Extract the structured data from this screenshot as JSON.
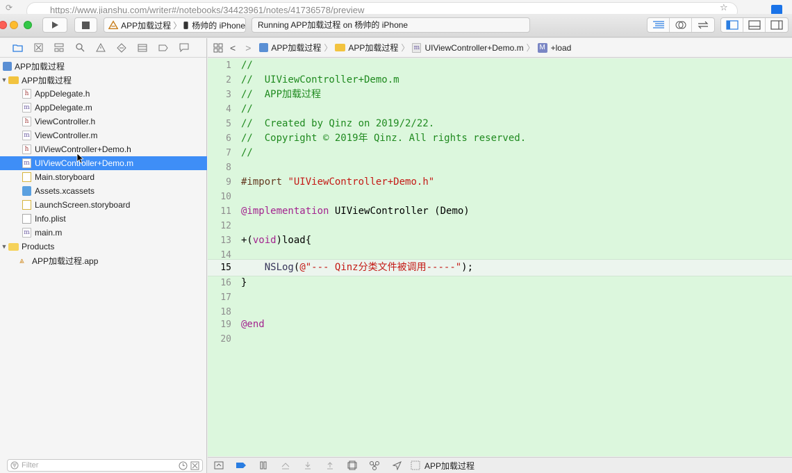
{
  "browser": {
    "url": "https://www.jianshu.com/writer#/notebooks/34423961/notes/41736578/preview"
  },
  "toolbar": {
    "scheme_name": "APP加载过程",
    "device_name": "杨帅的 iPhone",
    "status_text": "Running APP加载过程 on 杨帅的 iPhone"
  },
  "navigator": {
    "project": "APP加载过程",
    "group": "APP加载过程",
    "files": [
      {
        "name": "AppDelegate.h",
        "type": "h"
      },
      {
        "name": "AppDelegate.m",
        "type": "m"
      },
      {
        "name": "ViewController.h",
        "type": "h"
      },
      {
        "name": "ViewController.m",
        "type": "m"
      },
      {
        "name": "UIViewController+Demo.h",
        "type": "h"
      },
      {
        "name": "UIViewController+Demo.m",
        "type": "m",
        "selected": true
      },
      {
        "name": "Main.storyboard",
        "type": "storyboard"
      },
      {
        "name": "Assets.xcassets",
        "type": "assets"
      },
      {
        "name": "LaunchScreen.storyboard",
        "type": "storyboard"
      },
      {
        "name": "Info.plist",
        "type": "plist"
      },
      {
        "name": "main.m",
        "type": "m"
      }
    ],
    "products_group": "Products",
    "product": "APP加载过程.app",
    "filter_placeholder": "Filter"
  },
  "jumpbar": {
    "project": "APP加载过程",
    "group": "APP加载过程",
    "file": "UIViewController+Demo.m",
    "method_badge": "M",
    "method": "+load"
  },
  "editor": {
    "current_line": 15,
    "line_numbers": [
      "1",
      "2",
      "3",
      "4",
      "5",
      "6",
      "7",
      "8",
      "9",
      "10",
      "11",
      "12",
      "13",
      "14",
      "15",
      "16",
      "17",
      "18",
      "19",
      "20"
    ],
    "lines": {
      "l1": "//",
      "l2": "//  UIViewController+Demo.m",
      "l3": "//  APP加载过程",
      "l4": "//",
      "l5": "//  Created by Qinz on 2019/2/22.",
      "l6": "//  Copyright © 2019年 Qinz. All rights reserved.",
      "l7": "//",
      "l9_kw": "#import",
      "l9_str": "\"UIViewController+Demo.h\"",
      "l11_kw": "@implementation",
      "l11_rest": " UIViewController (Demo)",
      "l13_a": "+(",
      "l13_kw": "void",
      "l13_b": ")load{",
      "l15_indent": "    ",
      "l15_fn": "NSLog",
      "l15_open": "(",
      "l15_str": "@\"--- Qinz分类文件被调用-----\"",
      "l15_close": ");",
      "l16": "}",
      "l19_kw": "@end"
    }
  },
  "bottombar": {
    "target": "APP加载过程"
  },
  "colors": {
    "editor_bg": "#dcf7dd",
    "comment": "#1f8a1f",
    "string": "#c41a16",
    "keyword": "#a3248f",
    "selection": "#3e8ef7"
  }
}
